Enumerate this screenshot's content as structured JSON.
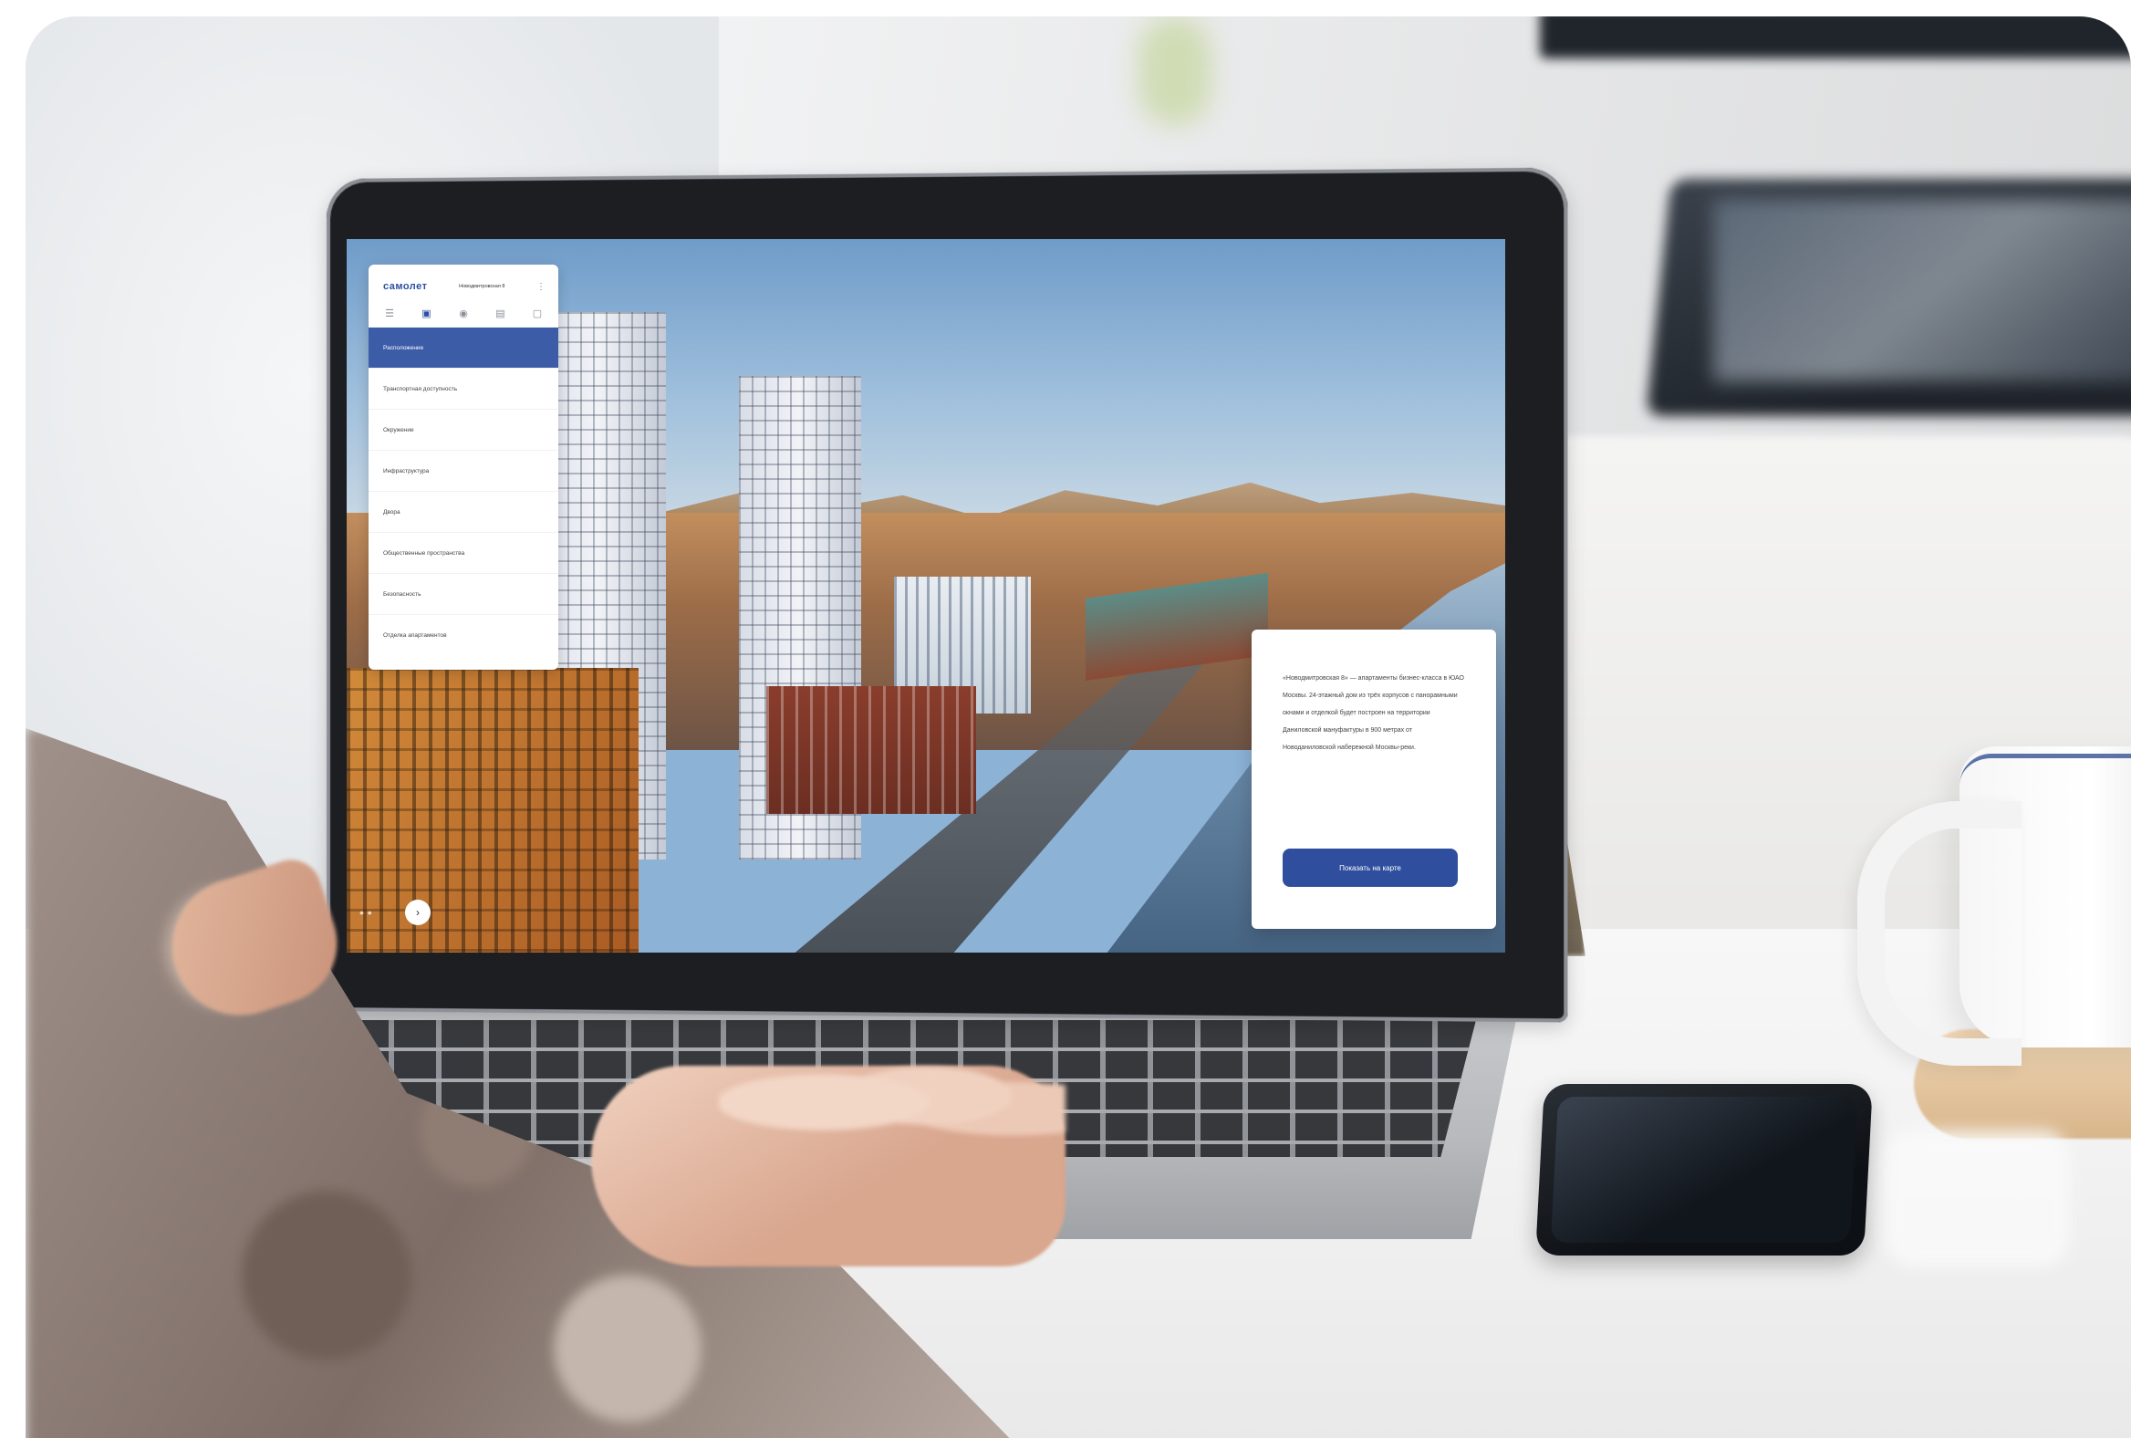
{
  "panel": {
    "logo": "самолет",
    "project": "Новодмитровская 8",
    "icons": [
      "menu-icon",
      "document-icon",
      "location-pin-icon",
      "list-icon",
      "gallery-icon"
    ],
    "menu": [
      {
        "label": "Расположение",
        "active": true
      },
      {
        "label": "Транспортная доступность",
        "active": false
      },
      {
        "label": "Окружение",
        "active": false
      },
      {
        "label": "Инфраструктура",
        "active": false
      },
      {
        "label": "Двора",
        "active": false
      },
      {
        "label": "Общественные пространства",
        "active": false
      },
      {
        "label": "Безопасность",
        "active": false
      },
      {
        "label": "Отделка апартаментов",
        "active": false
      }
    ]
  },
  "card": {
    "text": "«Новодмитровская 8» — апартаменты бизнес-класса в ЮАО Москвы. 24-этажный дом из трёх корпусов с панорамными окнами и отделкой будет построен на территории Даниловской мануфактуры в 900 метрах от Новоданиловской набережной Москвы-реки.",
    "button_label": "Показать на карте"
  },
  "controls": {
    "next_icon": "arrow-right-icon"
  },
  "colors": {
    "brand": "#2b4fa1",
    "active_menu": "#3c5ca8",
    "button": "#2f4f9e"
  }
}
